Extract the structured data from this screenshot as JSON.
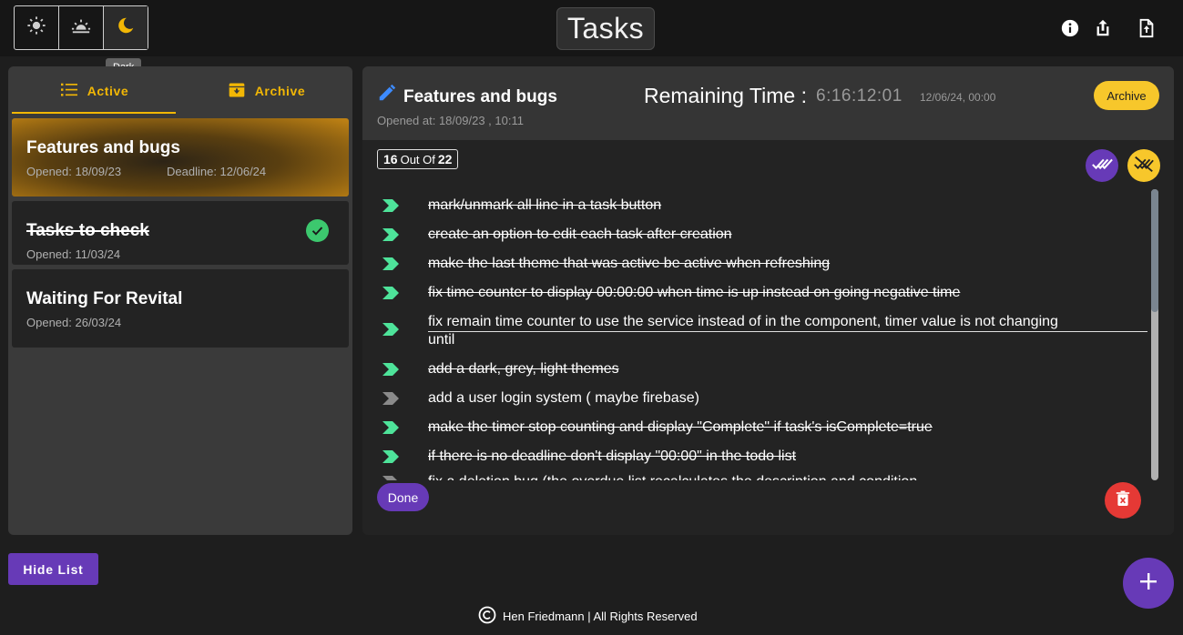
{
  "theme": {
    "options": [
      {
        "name": "light",
        "icon": "sun-icon"
      },
      {
        "name": "grey",
        "icon": "sunset-icon"
      },
      {
        "name": "dark",
        "icon": "moon-icon"
      }
    ],
    "active": "dark",
    "tooltip": "Dark"
  },
  "app": {
    "title": "Tasks"
  },
  "toolbar": {
    "icons": [
      "info-icon",
      "share-icon",
      "upload-file-icon"
    ]
  },
  "sidebar": {
    "tabs": [
      {
        "label": "Active",
        "icon": "list-icon"
      },
      {
        "label": "Archive",
        "icon": "archive-box-icon"
      }
    ],
    "tasks": [
      {
        "title": "Features and bugs",
        "opened": "Opened: 18/09/23",
        "deadline": "Deadline: 12/06/24",
        "selected": true,
        "completed": false
      },
      {
        "title": "Tasks to check",
        "opened": "Opened: 11/03/24",
        "deadline": "",
        "selected": false,
        "completed": true
      },
      {
        "title": "Waiting For Revital",
        "opened": "Opened: 26/03/24",
        "deadline": "",
        "selected": false,
        "completed": false
      }
    ]
  },
  "detail": {
    "title": "Features and bugs",
    "opened_at": "Opened at: 18/09/23 , 10:11",
    "remaining_label": "Remaining Time :",
    "remaining_value": "6:16:12:01",
    "deadline": "12/06/24, 00:00",
    "archive_label": "Archive",
    "counter": {
      "done": "16",
      "middle": "Out Of",
      "total": "22"
    },
    "items": [
      {
        "text": "mark/unmark all line in a task button",
        "done": true
      },
      {
        "text": "create an option to edit each task after creation",
        "done": true
      },
      {
        "text": "make the last theme that was active be active when refreshing",
        "done": true
      },
      {
        "text": "fix time counter to display 00:00:00 when time is up instead on going negative time",
        "done": true
      },
      {
        "text": "fix remain time counter to use the service instead of in the component, timer value is not changing",
        "text2": "until",
        "done": true
      },
      {
        "text": "add a dark, grey, light themes",
        "done": true
      },
      {
        "text": "add a user login system ( maybe firebase)",
        "done": false
      },
      {
        "text": "make the timer stop counting and display \"Complete\" if task's isComplete=true",
        "done": true
      },
      {
        "text": "if there is no deadline don't display \"00:00\" in the todo list",
        "done": true
      },
      {
        "text": "fix a deletion bug (the overdue list recalculates the description and condition",
        "done": false
      }
    ],
    "done_label": "Done"
  },
  "hide_list_label": "Hide List",
  "footer": {
    "text": "Hen Friedmann | All Rights Reserved"
  },
  "colors": {
    "accent": "#f2b705",
    "primary": "#673ab7",
    "check": "#3cc86e",
    "delete": "#e53935",
    "bullet_done": "#4ee39a",
    "bullet_open": "#8a8a8a"
  }
}
